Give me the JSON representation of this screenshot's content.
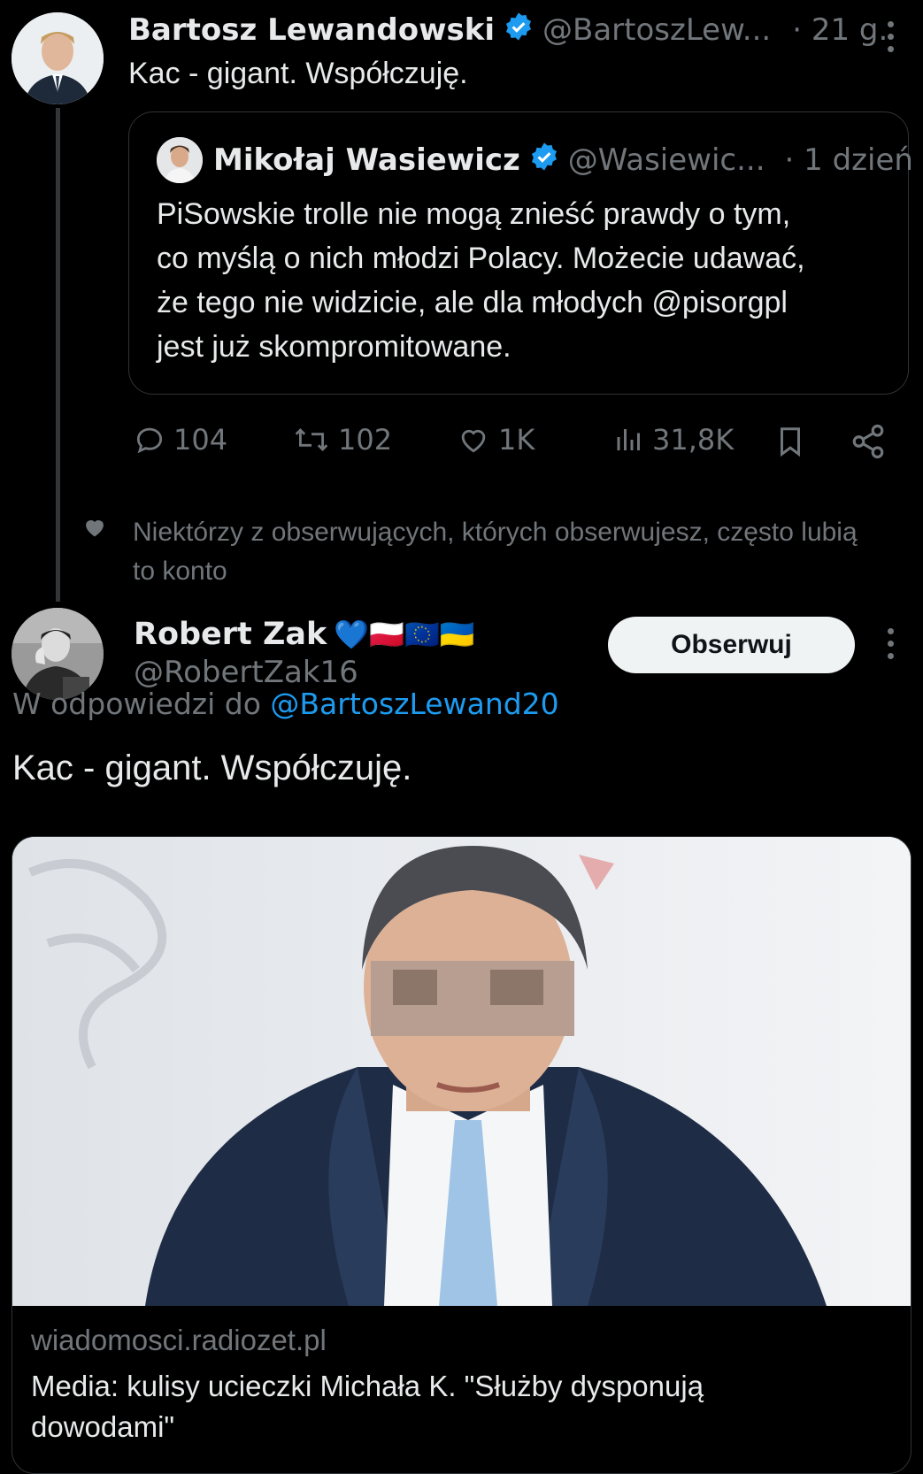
{
  "main_tweet": {
    "author_name": "Bartosz Lewandowski",
    "author_handle": "@BartoszLew...",
    "time": "· 21 g.",
    "text": "Kac - gigant. Współczuję.",
    "quoted": {
      "author_name": "Mikołaj Wasiewicz",
      "author_handle": "@Wasiewic...",
      "time": "· 1 dzień",
      "text_lines": [
        "PiSowskie trolle nie mogą znieść prawdy o tym,",
        "co myślą o nich młodzi Polacy. Możecie udawać,",
        "że tego nie widzicie, ale dla młodych @pisorgpl",
        "jest już skompromitowane."
      ]
    },
    "actions": {
      "replies": "104",
      "reposts": "102",
      "likes": "1K",
      "views": "31,8K"
    }
  },
  "social_context": {
    "line1": "Niektórzy z obserwujących, których obserwujesz, często lubią",
    "line2": "to konto"
  },
  "reply_tweet": {
    "author_name": "Robert Zak",
    "author_emojis": "💙🇵🇱🇪🇺🇺🇦",
    "author_handle": "@RobertZak16",
    "follow_label": "Obserwuj",
    "replying_to_prefix": "W odpowiedzi do",
    "replying_to_handle": "@BartoszLewand20",
    "text": "Kac - gigant. Współczuję.",
    "link_card": {
      "domain": "wiadomosci.radiozet.pl",
      "title_line1": "Media: kulisy ucieczki Michała K. \"Służby dysponują",
      "title_line2": "dowodami\""
    }
  },
  "colors": {
    "background": "#000000",
    "text": "#e7e9ea",
    "muted": "#71767b",
    "link": "#1d9bf0",
    "verified": "#1d9bf0"
  }
}
